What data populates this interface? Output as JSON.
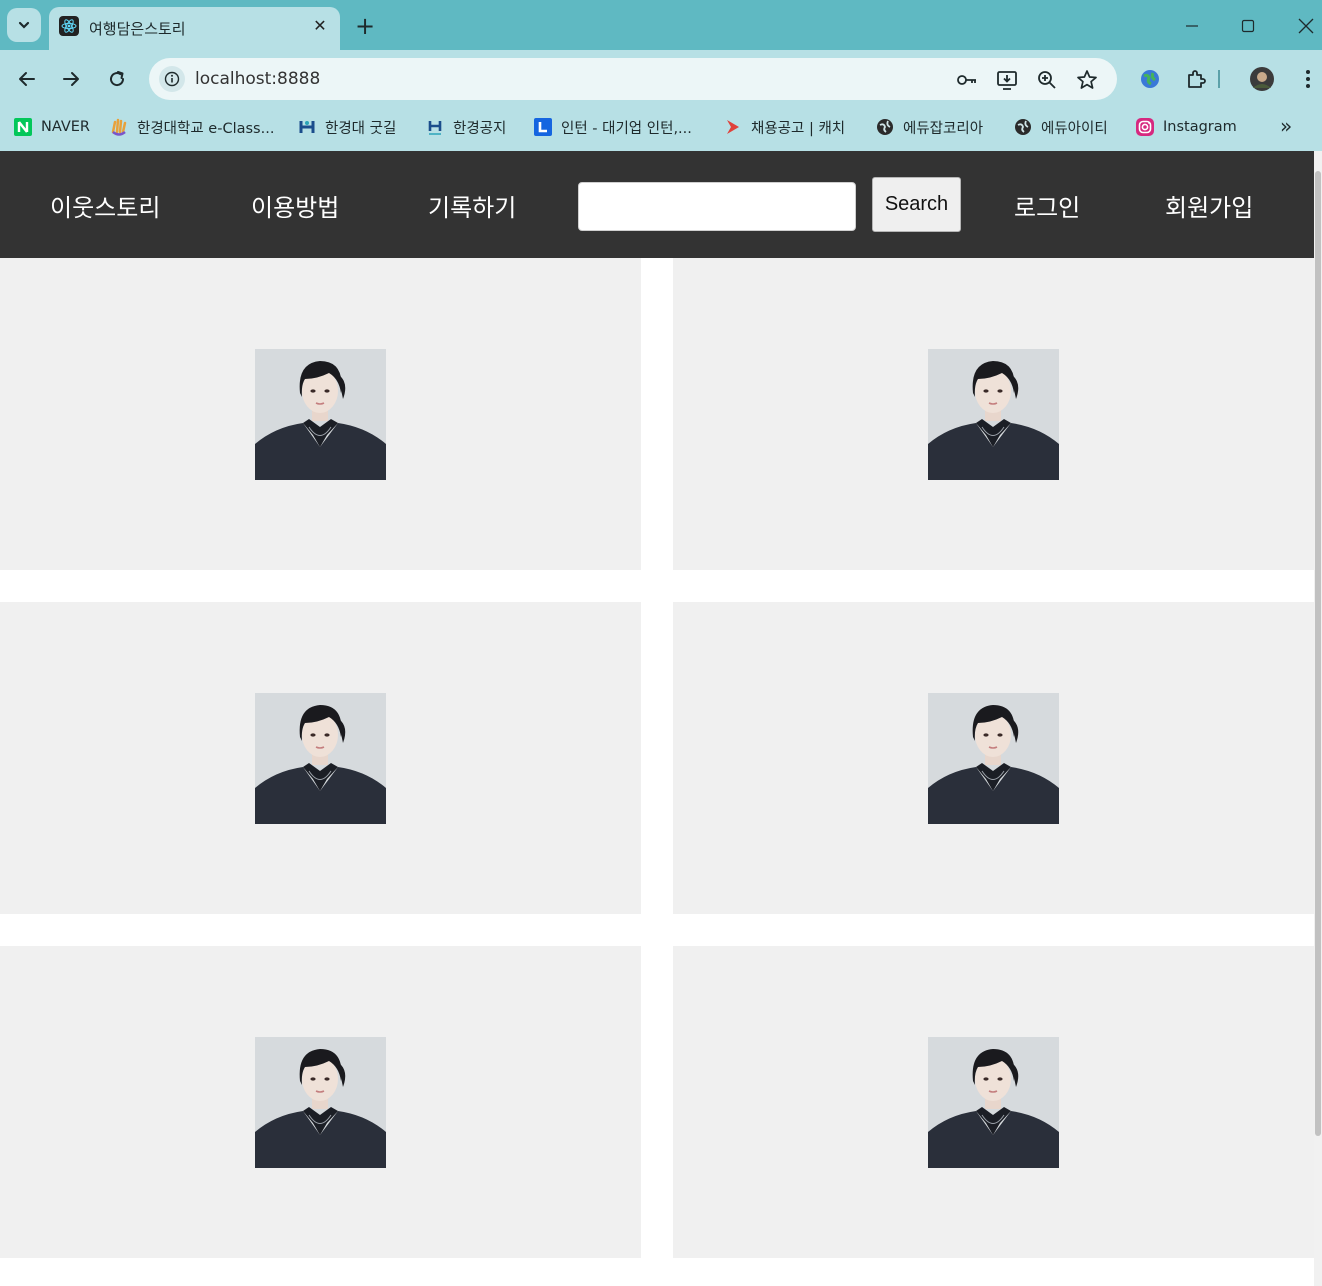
{
  "browser": {
    "tab": {
      "title": "여행담은스토리"
    },
    "address": {
      "url": "localhost:8888"
    },
    "bookmarks": [
      {
        "label": "NAVER",
        "icon": "naver-icon"
      },
      {
        "label": "한경대학교 e-Class...",
        "icon": "hand-icon"
      },
      {
        "label": "한경대 굿길",
        "icon": "hk-logo-icon"
      },
      {
        "label": "한경공지",
        "icon": "hk-logo-icon"
      },
      {
        "label": "인턴 - 대기업 인턴,...",
        "icon": "linkareer-icon"
      },
      {
        "label": "채용공고 | 캐치",
        "icon": "catch-icon"
      },
      {
        "label": "에듀잡코리아",
        "icon": "globe-icon"
      },
      {
        "label": "에듀아이티",
        "icon": "globe-icon"
      },
      {
        "label": "Instagram",
        "icon": "instagram-icon"
      }
    ],
    "bookmarks_overflow": "»"
  },
  "nav": {
    "brand": "이웃스토리",
    "how_to": "이용방법",
    "record": "기록하기",
    "search_placeholder": "",
    "search_button": "Search",
    "login": "로그인",
    "signup": "회원가입"
  },
  "cards": [
    {
      "image": "profile-photo"
    },
    {
      "image": "profile-photo"
    },
    {
      "image": "profile-photo"
    },
    {
      "image": "profile-photo"
    },
    {
      "image": "profile-photo"
    },
    {
      "image": "profile-photo"
    }
  ],
  "colors": {
    "titlebar": "#5fb9c2",
    "toolbar": "#b7e0e5",
    "navbar": "#333333",
    "card": "#f0f0f0"
  }
}
